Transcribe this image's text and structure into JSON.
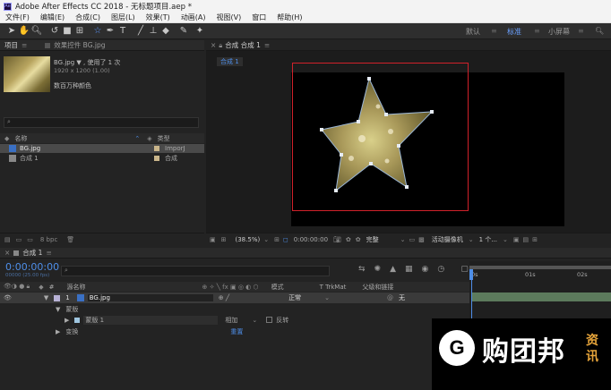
{
  "titlebar": {
    "app_icon": "Ae",
    "title": "Adobe After Effects CC 2018 - 无标题项目.aep *"
  },
  "menu": [
    "文件(F)",
    "编辑(E)",
    "合成(C)",
    "图层(L)",
    "效果(T)",
    "动画(A)",
    "视图(V)",
    "窗口",
    "帮助(H)"
  ],
  "workspaces": {
    "default": "默认",
    "standard": "标准",
    "small": "小屏幕"
  },
  "project_panel": {
    "tab_label": "项目",
    "effects_tab": "效果控件 BG.jpg",
    "asset_name": "BG.jpg ▼ , 使用了 1 次",
    "asset_dims": "1920 x 1200 (1.00)",
    "asset_colors": "数百万种颜色",
    "col_name": "名称",
    "col_type": "类型",
    "items": [
      {
        "name": "BG.jpg",
        "type": "ImporJ"
      },
      {
        "name": "合成 1",
        "type": "合成"
      }
    ],
    "bpc": "8 bpc"
  },
  "comp_panel": {
    "tab_label": "合成 合成 1",
    "breadcrumb": "合成 1",
    "zoom": "(38.5%)",
    "timecode": "0:00:00:00",
    "quality": "完整",
    "camera": "活动摄像机",
    "views": "1 个..."
  },
  "timeline": {
    "tab_label": "合成 1",
    "timecode": "0:00:00:00",
    "fps": "00000 (25.00 fps)",
    "col_num": "#",
    "col_source": "源名称",
    "col_mode": "模式",
    "col_trkmat": "T  TrkMat",
    "col_parent": "父级和链接",
    "layer": {
      "num": "1",
      "name": "BG.jpg",
      "mode": "正常",
      "parent": "无"
    },
    "masks_label": "蒙版",
    "mask1": "蒙版 1",
    "mask_mode": "相加",
    "mask_invert": "反转",
    "transform_label": "变换",
    "reset": "重置",
    "ruler": [
      "0s",
      "01s",
      "02s"
    ]
  },
  "watermark": {
    "brand": "购团邦",
    "tag1": "资",
    "tag2": "讯"
  },
  "colors": {
    "accent": "#4e8ee8",
    "selection_box": "#d0212a",
    "bg": "#232323"
  }
}
